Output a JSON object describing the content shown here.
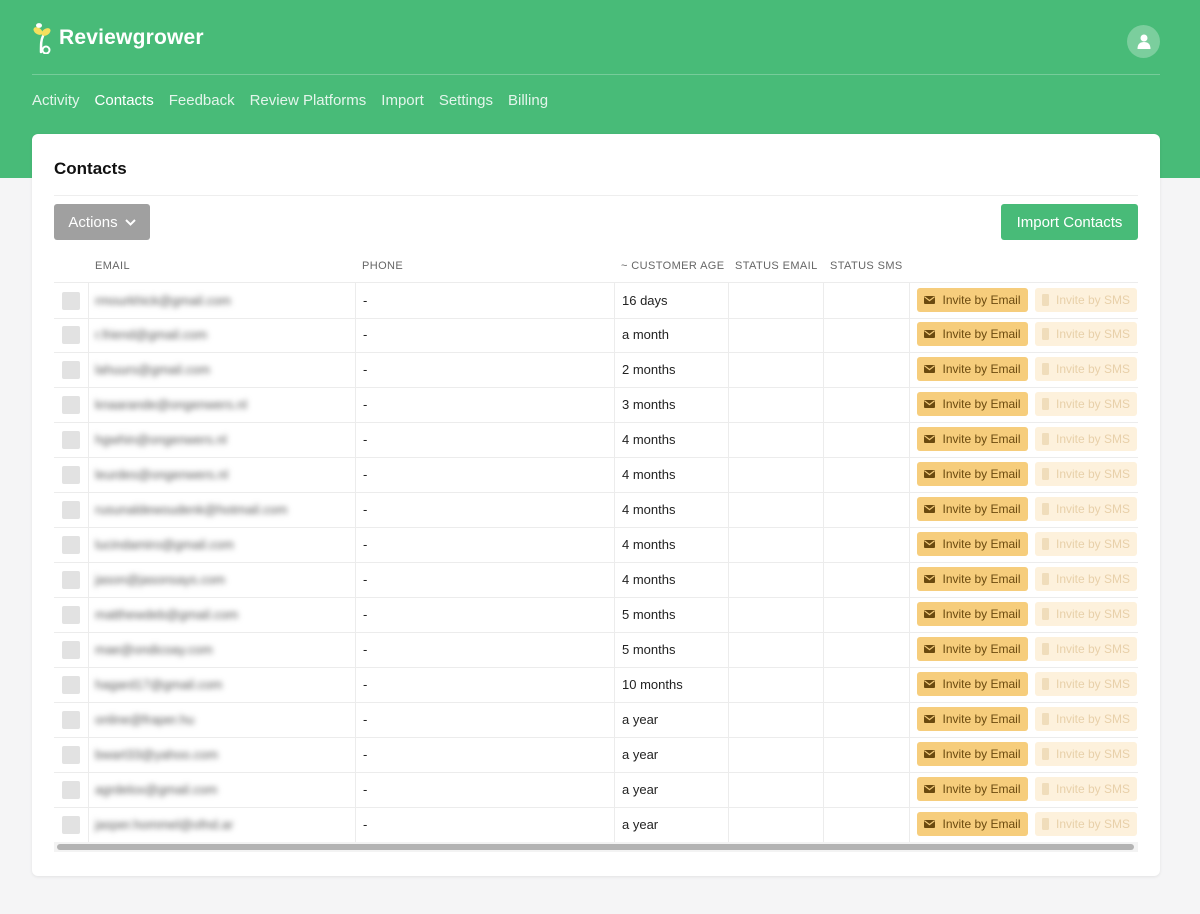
{
  "brand": {
    "name": "Reviewgrower",
    "color": "#48bb78"
  },
  "header": {
    "avatar_icon": "user-icon"
  },
  "nav": [
    {
      "label": "Activity",
      "active": false
    },
    {
      "label": "Contacts",
      "active": true
    },
    {
      "label": "Feedback",
      "active": false
    },
    {
      "label": "Review Platforms",
      "active": false
    },
    {
      "label": "Import",
      "active": false
    },
    {
      "label": "Settings",
      "active": false
    },
    {
      "label": "Billing",
      "active": false
    }
  ],
  "page": {
    "title": "Contacts",
    "actions_label": "Actions",
    "import_label": "Import Contacts"
  },
  "table": {
    "columns": [
      "EMAIL",
      "PHONE",
      "~ CUSTOMER AGE",
      "STATUS EMAIL",
      "STATUS SMS"
    ],
    "invite_email_label": "Invite by Email",
    "invite_sms_label": "Invite by SMS",
    "rows": [
      {
        "email": "rmourkhick@gmail.com",
        "phone": "-",
        "age": "16 days"
      },
      {
        "email": "r.friend@gmail.com",
        "phone": "-",
        "age": "a month"
      },
      {
        "email": "lahuurs@gmail.com",
        "phone": "-",
        "age": "2 months"
      },
      {
        "email": "knaarande@ongenwers.nl",
        "phone": "-",
        "age": "3 months"
      },
      {
        "email": "hgwhin@ongenwers.nl",
        "phone": "-",
        "age": "4 months"
      },
      {
        "email": "leurdes@ongenwers.nl",
        "phone": "-",
        "age": "4 months"
      },
      {
        "email": "rusunaldewoudenk@hotmail.com",
        "phone": "-",
        "age": "4 months"
      },
      {
        "email": "lucindamiro@gmail.com",
        "phone": "-",
        "age": "4 months"
      },
      {
        "email": "jason@jasonsays.com",
        "phone": "-",
        "age": "4 months"
      },
      {
        "email": "matthewdeb@gmail.com",
        "phone": "-",
        "age": "5 months"
      },
      {
        "email": "mae@ondicoay.com",
        "phone": "-",
        "age": "5 months"
      },
      {
        "email": "hagard17@gmail.com",
        "phone": "-",
        "age": "10 months"
      },
      {
        "email": "online@fraper.hu",
        "phone": "-",
        "age": "a year"
      },
      {
        "email": "bwart33@yahoo.com",
        "phone": "-",
        "age": "a year"
      },
      {
        "email": "agrdelox@gmail.com",
        "phone": "-",
        "age": "a year"
      },
      {
        "email": "jasper.hommel@ofnd.ar",
        "phone": "-",
        "age": "a year"
      }
    ]
  }
}
